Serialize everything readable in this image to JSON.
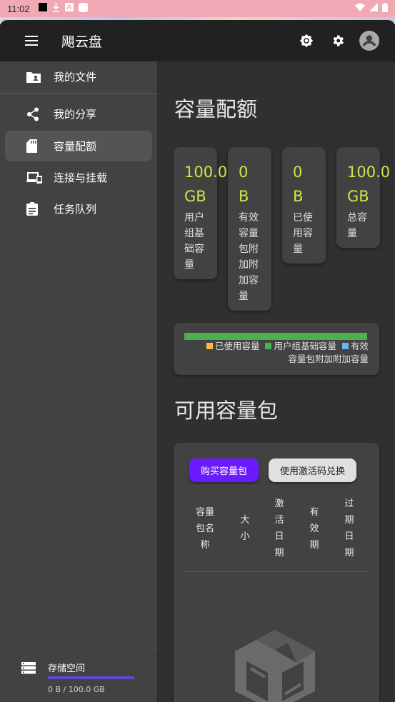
{
  "status_bar": {
    "time": "11:02"
  },
  "app_bar": {
    "title": "飓云盘"
  },
  "drawer": {
    "items": [
      {
        "label": "我的文件",
        "icon": "folder-account-icon"
      },
      {
        "label": "我的分享",
        "icon": "share-icon"
      },
      {
        "label": "容量配额",
        "icon": "sd-card-icon",
        "active": true
      },
      {
        "label": "连接与挂载",
        "icon": "devices-icon"
      },
      {
        "label": "任务队列",
        "icon": "clipboard-list-icon"
      }
    ],
    "storage": {
      "title": "存储空间",
      "usage": "0 B / 100.0 GB",
      "used_fraction": 0
    }
  },
  "quota": {
    "heading": "容量配额",
    "stats": [
      {
        "value_line1": "100.0",
        "value_line2": "GB",
        "desc_lines": [
          "用户",
          "组基",
          "础容",
          "量"
        ]
      },
      {
        "value_line1": "0",
        "value_line2": "B",
        "desc_lines": [
          "有效",
          "容量",
          "包附",
          "加附",
          "加容",
          "量"
        ]
      },
      {
        "value_line1": "0",
        "value_line2": "B",
        "desc_lines": [
          "已使",
          "用容",
          "量"
        ]
      },
      {
        "value_line1": "100.0",
        "value_line2": "GB",
        "desc_lines": [
          "总容",
          "量"
        ]
      }
    ],
    "legend": [
      {
        "label": "已使用容量",
        "color": "#ffb74d"
      },
      {
        "label": "用户组基础容量",
        "color": "#4caf50"
      },
      {
        "label": "有效",
        "color": "#64b5f6"
      }
    ],
    "legend_line2": "容量包附加附加容量"
  },
  "packs": {
    "heading": "可用容量包",
    "buy_label": "购买容量包",
    "redeem_label": "使用激活码兑换",
    "columns": [
      [
        "容量",
        "包名",
        "称"
      ],
      [
        "大",
        "小"
      ],
      [
        "激",
        "活",
        "日",
        "期"
      ],
      [
        "有",
        "效",
        "期"
      ],
      [
        "过",
        "期",
        "日",
        "期"
      ]
    ]
  },
  "colors": {
    "accent": "#6a1bff",
    "value": "#c6e94a",
    "bar": "#4caf50"
  }
}
